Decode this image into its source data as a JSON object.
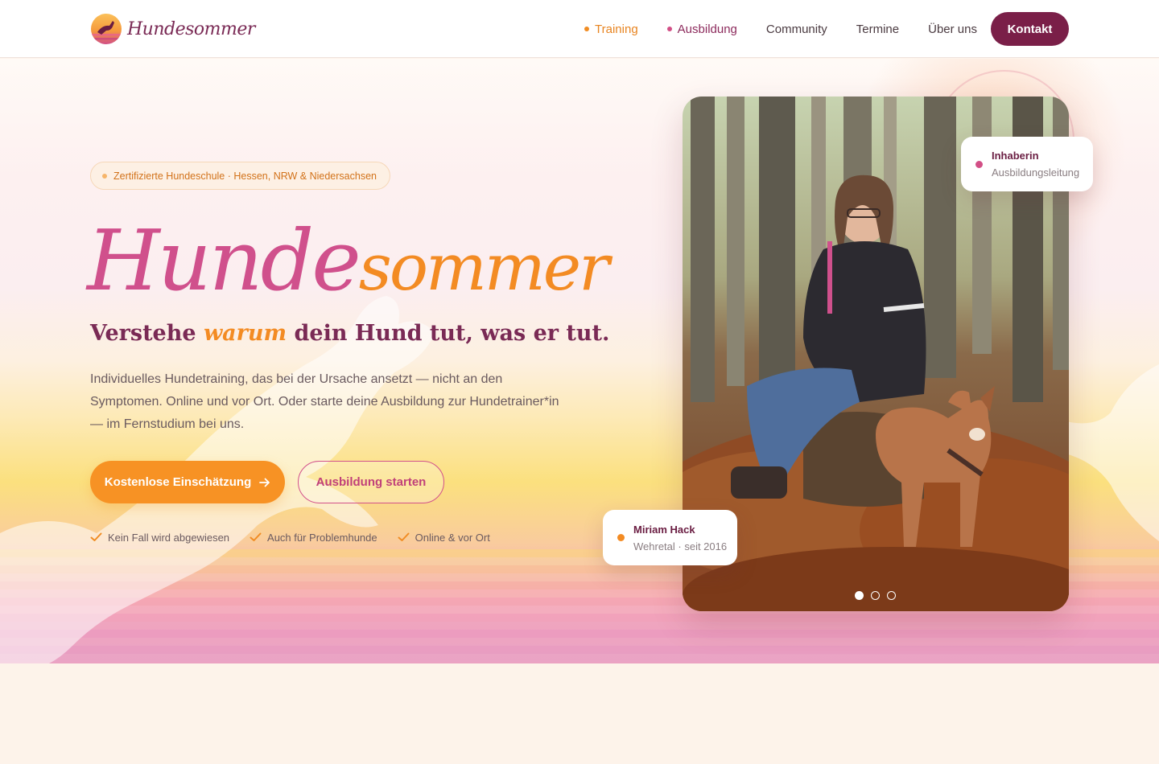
{
  "header": {
    "logo_text": "Hundesommer",
    "nav": [
      {
        "label": "Training"
      },
      {
        "label": "Ausbildung"
      },
      {
        "label": "Community"
      },
      {
        "label": "Termine"
      },
      {
        "label": "Über uns"
      }
    ],
    "cta_label": "Kontakt"
  },
  "hero": {
    "badge": "Zertifizierte Hundeschule · Hessen, NRW & Niedersachsen",
    "script_title_part1": "Hunde",
    "script_title_part2": "sommer",
    "headline_before": "Verstehe ",
    "headline_emphasis": "warum",
    "headline_after": " dein Hund tut, was er tut.",
    "lead": "Individuelles Hundetraining, das bei der Ursache ansetzt — nicht an den Symptomen. Online und vor Ort. Oder starte deine Ausbildung zur Hundetrainer*in — im Fernstudium bei uns.",
    "primary_button": "Kostenlose Einschätzung",
    "secondary_button": "Ausbildung starten",
    "checks": [
      "Kein Fall wird abgewiesen",
      "Auch für Problemhunde",
      "Online & vor Ort"
    ]
  },
  "photo_cards": {
    "top": {
      "title": "Inhaberin",
      "subtitle": "Ausbildungsleitung"
    },
    "bottom": {
      "title": "Miriam Hack",
      "subtitle": "Wehretal · seit 2016"
    }
  },
  "carousel": {
    "slide_count": 3,
    "active_index": 0
  },
  "colors": {
    "brand_plum": "#7a1f48",
    "brand_pink": "#d0508c",
    "brand_orange": "#f79224",
    "check_orange": "#f08c23"
  },
  "icons": [
    "logo-sun-dog-icon",
    "arrow-right-icon",
    "check-icon"
  ]
}
